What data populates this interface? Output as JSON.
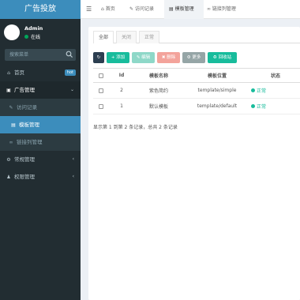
{
  "sidebar": {
    "brand": "广告投放",
    "user": {
      "name": "Admin",
      "status": "在线"
    },
    "search_placeholder": "搜索菜单",
    "items": [
      {
        "label": "首页",
        "icon": "home-icon",
        "badge": "hot"
      },
      {
        "label": "广告管理",
        "icon": "image-icon"
      },
      {
        "label": "访问记录",
        "icon": "pencil-icon"
      },
      {
        "label": "模板管理",
        "icon": "template-icon"
      },
      {
        "label": "链接列管理",
        "icon": "link-icon"
      },
      {
        "label": "常规管理",
        "icon": "gear-icon"
      },
      {
        "label": "权限管理",
        "icon": "users-icon"
      }
    ]
  },
  "topbar": {
    "tabs": [
      {
        "label": "首页",
        "icon": "home-icon"
      },
      {
        "label": "访问记录",
        "icon": "pencil-icon"
      },
      {
        "label": "模板管理",
        "icon": "template-icon"
      },
      {
        "label": "链接列管理",
        "icon": "link-icon"
      }
    ]
  },
  "filter_tabs": [
    "全部",
    "关闭",
    "正常"
  ],
  "toolbar": {
    "add": "添加",
    "edit": "编辑",
    "delete": "删除",
    "more": "更多",
    "recycle": "回收站",
    "colors": {
      "refresh": "#2c3e50",
      "add": "#18bc9c",
      "edit": "#8ed8c8",
      "delete": "#f3a39b",
      "more": "#95a5a6",
      "recycle": "#18bc9c"
    }
  },
  "table": {
    "columns": [
      "Id",
      "模板名称",
      "模板位置",
      "状态"
    ],
    "rows": [
      {
        "id": "2",
        "name": "紫色简约",
        "path": "template/simple",
        "state": "正常"
      },
      {
        "id": "1",
        "name": "默认模板",
        "path": "template/default",
        "state": "正常"
      }
    ]
  },
  "pager": "显示第 1 到第 2 条记录，总共 2 条记录"
}
